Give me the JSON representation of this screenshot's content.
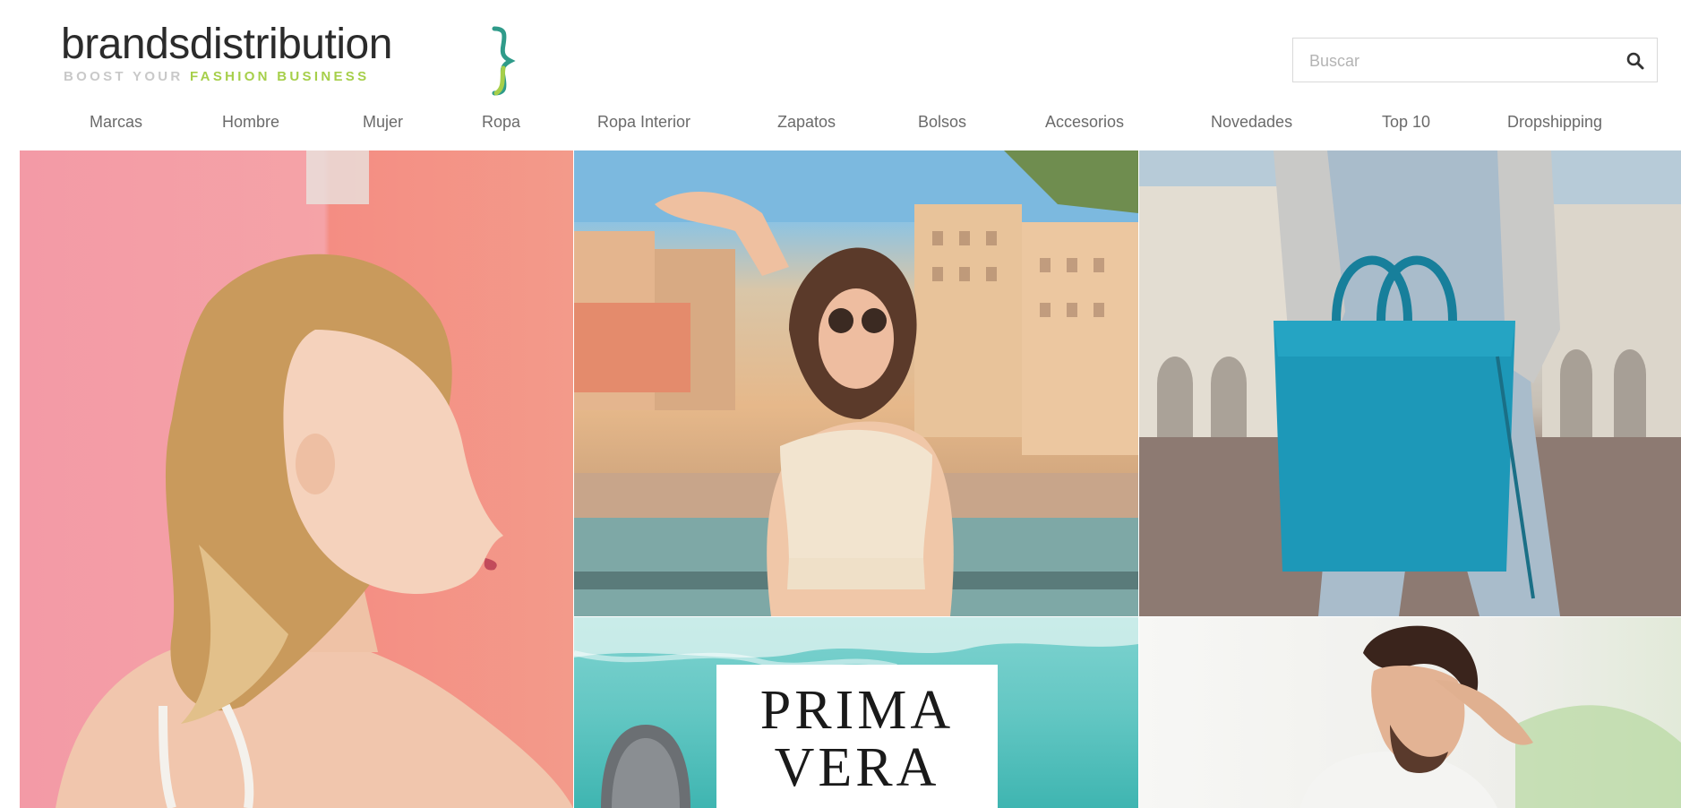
{
  "header": {
    "logo": {
      "name": "brandsdistribution",
      "tagline_part1": "BOOST YOUR ",
      "tagline_part2": "FASHION BUSINESS"
    },
    "search": {
      "placeholder": "Buscar",
      "value": ""
    }
  },
  "nav": {
    "items": [
      {
        "label": "Marcas"
      },
      {
        "label": "Hombre"
      },
      {
        "label": "Mujer"
      },
      {
        "label": "Ropa"
      },
      {
        "label": "Ropa Interior"
      },
      {
        "label": "Zapatos"
      },
      {
        "label": "Bolsos"
      },
      {
        "label": "Accesorios"
      },
      {
        "label": "Novedades"
      },
      {
        "label": "Top 10"
      },
      {
        "label": "Dropshipping"
      }
    ]
  },
  "banners": {
    "promo": {
      "line1": "PRIMA",
      "line2": "VERA"
    }
  },
  "colors": {
    "brand_green": "#a6cf4a",
    "text": "#2b2b2b",
    "nav_text": "#6a6a6a"
  },
  "icons": {
    "search": "magnifier-icon"
  }
}
